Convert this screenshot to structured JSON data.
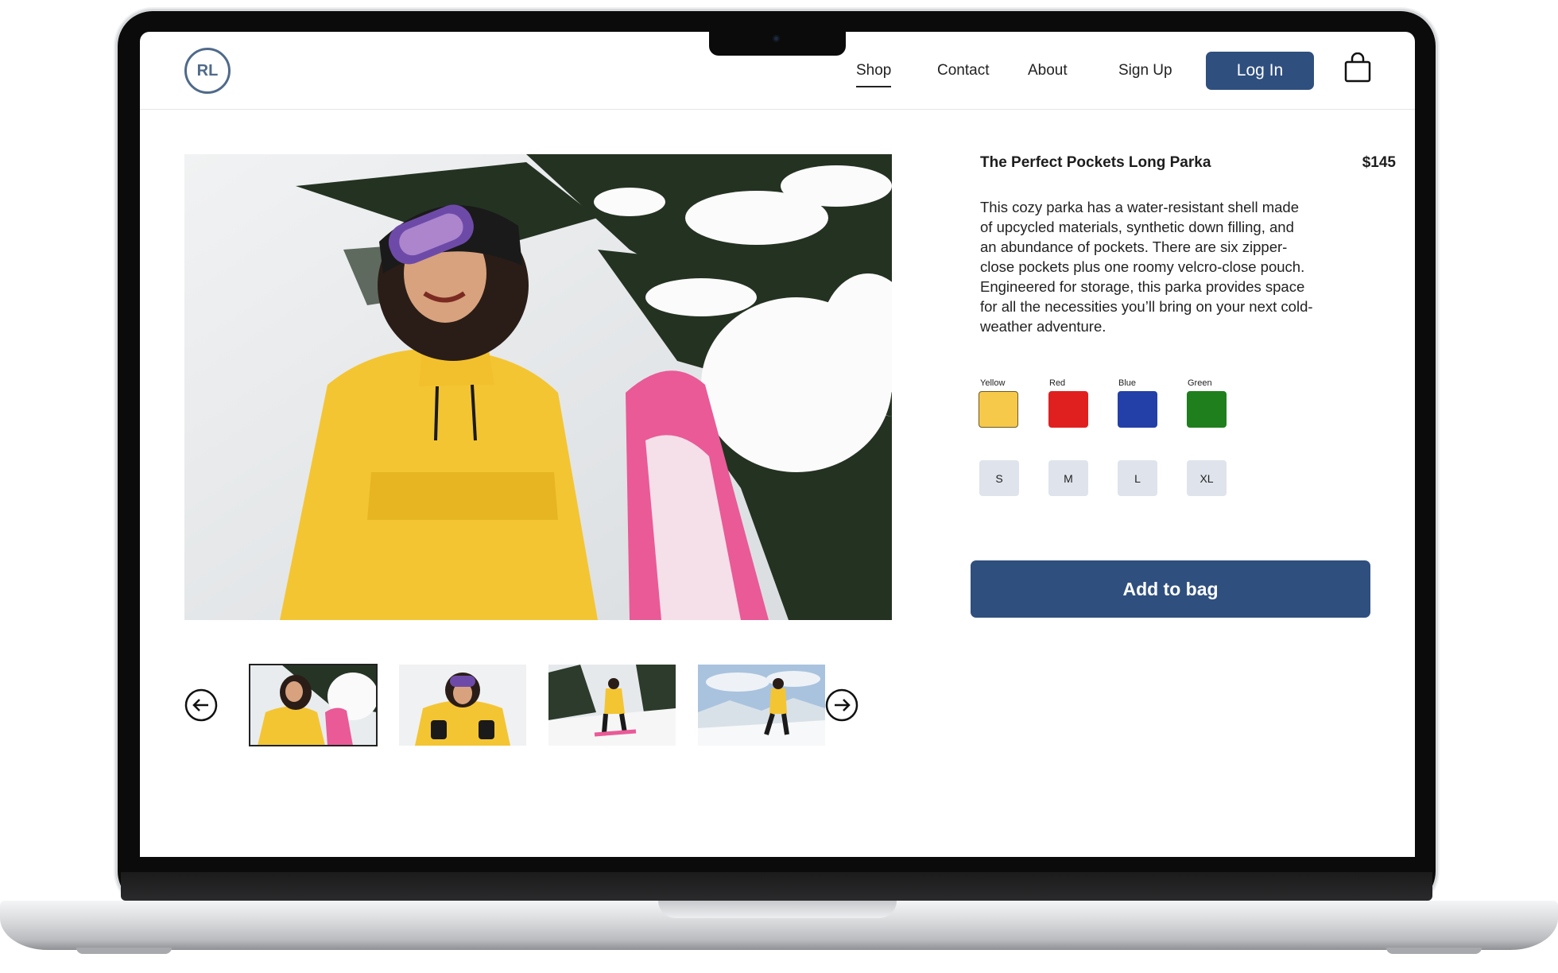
{
  "brand": {
    "logo_text": "RL"
  },
  "nav": {
    "links": [
      "Shop",
      "Contact",
      "About",
      "Sign Up"
    ],
    "active": "Shop",
    "login_label": "Log In",
    "bag_icon": "shopping-bag-icon"
  },
  "gallery": {
    "hero_image": "woman in yellow parka with goggles smiling beside snowy pine tree and pink snowboard",
    "thumbnails": [
      "woman in yellow parka beside snowy tree",
      "woman in yellow parka adjusting goggles",
      "snowboarder in yellow parka among pines",
      "woman in yellow parka walking on mountain ridge"
    ],
    "selected_thumbnail": 0,
    "prev_icon": "arrow-left-circle-icon",
    "next_icon": "arrow-right-circle-icon"
  },
  "product": {
    "title": "The Perfect Pockets Long Parka",
    "price": "$145",
    "description": "This cozy parka has a water-resistant shell made of upcycled materials, synthetic down filling, and an abundance of pockets. There are six zipper-close pockets plus one roomy velcro-close pouch. Engineered for storage, this parka provides space for all the necessities you’ll bring on your next cold-weather adventure.",
    "colors": [
      {
        "name": "Yellow",
        "hex": "#f6c94b"
      },
      {
        "name": "Red",
        "hex": "#e0201f"
      },
      {
        "name": "Blue",
        "hex": "#2340a8"
      },
      {
        "name": "Green",
        "hex": "#1f7f1c"
      }
    ],
    "selected_color": "Yellow",
    "sizes": [
      "S",
      "M",
      "L",
      "XL"
    ],
    "add_to_bag_label": "Add to bag"
  },
  "theme": {
    "accent": "#2f4f7e",
    "logo_color": "#4f6a8a"
  }
}
